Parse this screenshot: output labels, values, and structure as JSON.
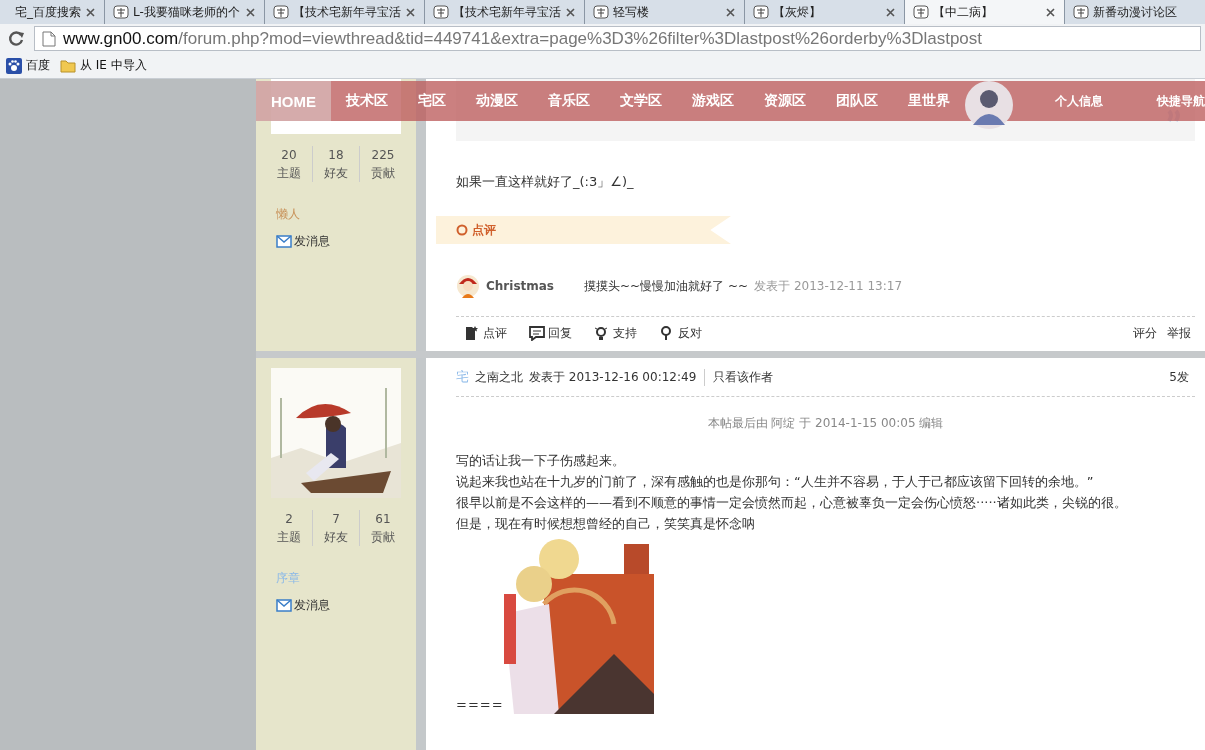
{
  "browser": {
    "tabs": [
      {
        "title": "宅_百度搜索",
        "selected": false
      },
      {
        "title": "L-我要猫咪老师的个",
        "selected": false
      },
      {
        "title": "【技术宅新年寻宝活",
        "selected": false
      },
      {
        "title": "【技术宅新年寻宝活",
        "selected": false
      },
      {
        "title": "轻写楼",
        "selected": false
      },
      {
        "title": "【灰烬】",
        "selected": false
      },
      {
        "title": "【中二病】",
        "selected": true
      },
      {
        "title": "新番动漫讨论区",
        "selected": false
      }
    ],
    "url_host": "www.gn00.com",
    "url_path": "/forum.php?mod=viewthread&tid=449741&extra=page%3D3%26filter%3Dlastpost%26orderby%3Dlastpost",
    "bookmarks": [
      {
        "label": "百度",
        "kind": "paw"
      },
      {
        "label": "从 IE 中导入",
        "kind": "folder"
      }
    ]
  },
  "nav": {
    "items": [
      {
        "label": "HOME",
        "selected": true
      },
      {
        "label": "技术区",
        "selected": false
      },
      {
        "label": "宅区",
        "selected": false
      },
      {
        "label": "动漫区",
        "selected": false
      },
      {
        "label": "音乐区",
        "selected": false
      },
      {
        "label": "文学区",
        "selected": false
      },
      {
        "label": "游戏区",
        "selected": false
      },
      {
        "label": "资源区",
        "selected": false
      },
      {
        "label": "团队区",
        "selected": false
      },
      {
        "label": "里世界",
        "selected": false
      }
    ],
    "user_links": [
      "个人信息",
      "快捷导航"
    ]
  },
  "posts": [
    {
      "sidebar": {
        "stats": [
          {
            "value": "20",
            "label": "主题"
          },
          {
            "value": "18",
            "label": "好友"
          },
          {
            "value": "225",
            "label": "贡献"
          }
        ],
        "rank": {
          "label": "懒人",
          "color": "#c8925a"
        },
        "message": "发消息"
      },
      "quote": {
        "kind": "quote"
      },
      "body": [
        "如果一直这样就好了_(:3」∠)_"
      ],
      "comment_header": "点评",
      "comments": [
        {
          "user": "Christmas",
          "text": "摸摸头~~慢慢加油就好了 ~~",
          "time": "发表于 2013-12-11 13:17"
        }
      ],
      "actions": [
        {
          "label": "点评",
          "kind": "note"
        },
        {
          "label": "回复",
          "kind": "reply"
        },
        {
          "label": "支持",
          "kind": "bulb"
        },
        {
          "label": "反对",
          "kind": "pin"
        }
      ],
      "right_actions": [
        "评分",
        "举报"
      ]
    },
    {
      "sidebar": {
        "stats": [
          {
            "value": "2",
            "label": "主题"
          },
          {
            "value": "7",
            "label": "好友"
          },
          {
            "value": "61",
            "label": "贡献"
          }
        ],
        "rank": {
          "label": "序章",
          "color": "#8ab8e8"
        },
        "message": "发消息"
      },
      "header": {
        "badge": "宅",
        "author": "之南之北",
        "posted": "发表于 2013-12-16 00:12:49",
        "only_author": "只看该作者",
        "floor": "5发"
      },
      "edit_note": "本帖最后由 阿绽 于 2014-1-15 00:05 编辑",
      "body": [
        "写的话让我一下子伤感起来。",
        "说起来我也站在十九岁的门前了，深有感触的也是你那句：“人生并不容易，于人于己都应该留下回转的余地。”",
        "很早以前是不会这样的——看到不顺意的事情一定会愤然而起，心意被辜负一定会伤心愤怒·····诸如此类，尖锐的很。",
        "但是，现在有时候想想曾经的自己，笑笑真是怀念呐"
      ],
      "tail": "===="
    }
  ]
}
